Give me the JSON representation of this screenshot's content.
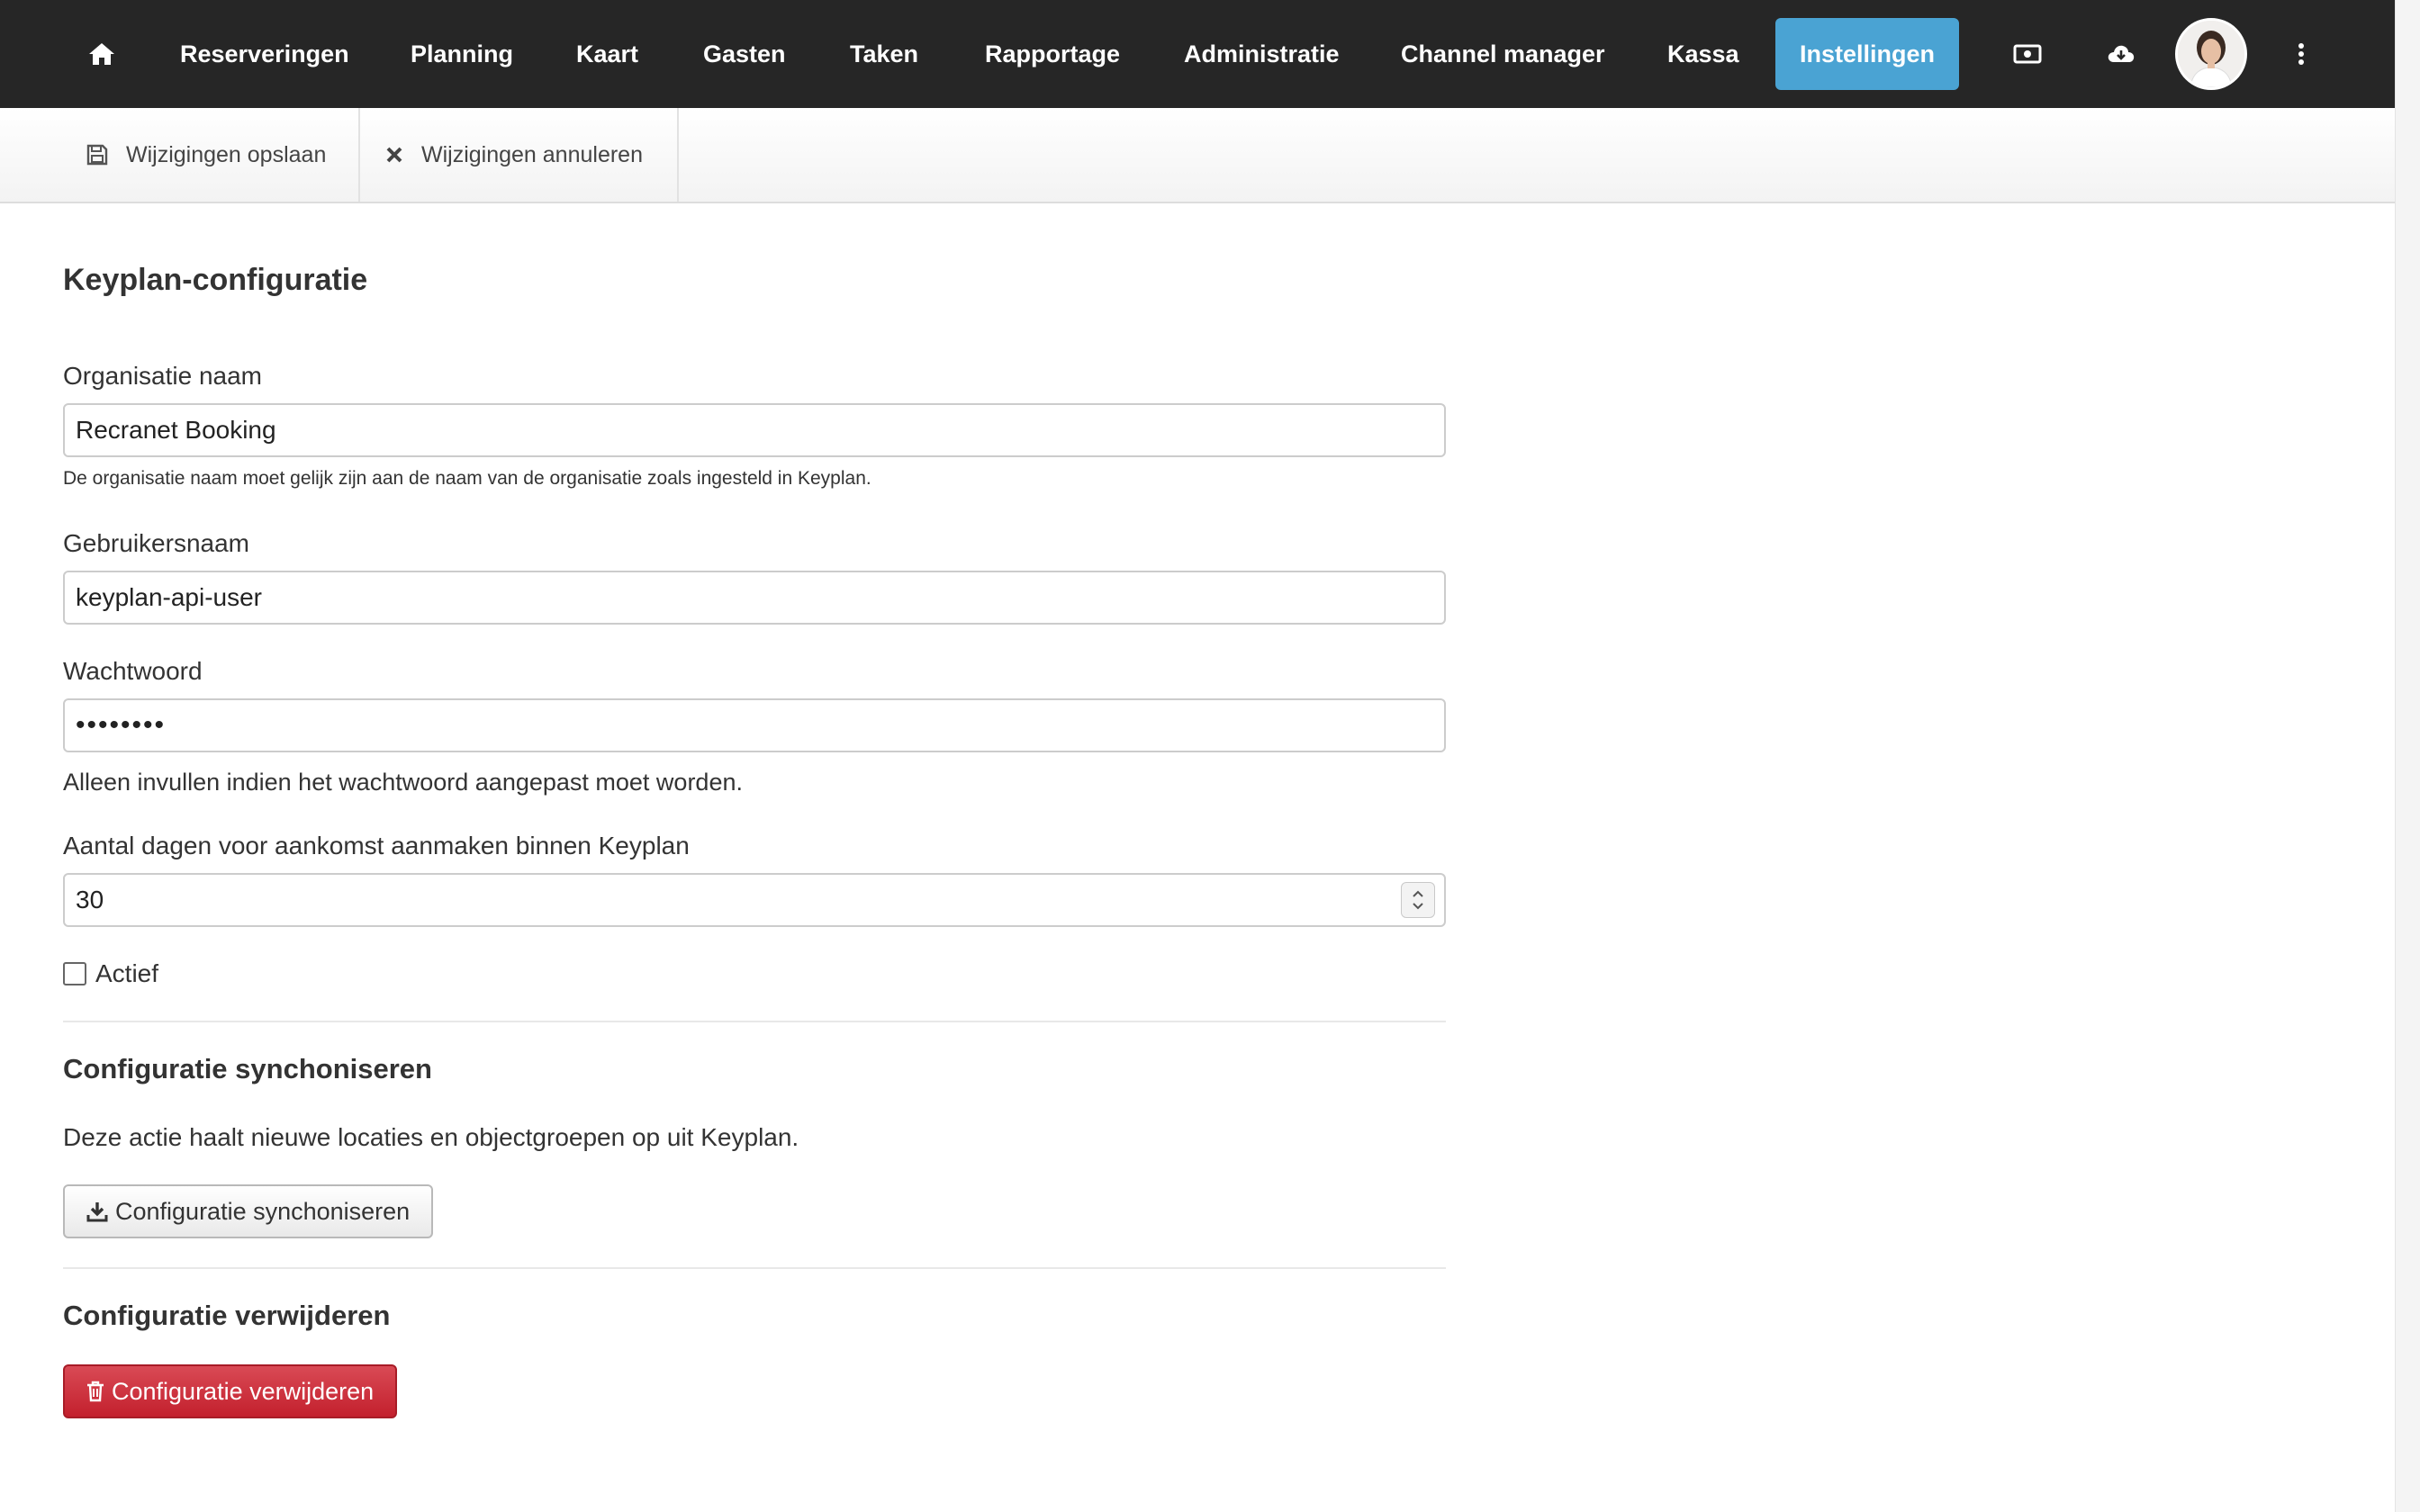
{
  "nav": {
    "home_icon": "home-icon",
    "items": [
      "Reserveringen",
      "Planning",
      "Kaart",
      "Gasten",
      "Taken",
      "Rapportage",
      "Administratie",
      "Channel manager",
      "Kassa"
    ],
    "active_item": "Instellingen",
    "active_color": "#4aa3d3",
    "right_icons": [
      "cash-register-icon",
      "cloud-download-icon",
      "avatar",
      "more-vertical-icon"
    ]
  },
  "toolbar": {
    "save_label": "Wijzigingen opslaan",
    "cancel_label": "Wijzigingen annuleren",
    "save_icon": "floppy-disk-icon",
    "cancel_icon": "close-icon"
  },
  "form": {
    "title": "Keyplan-configuratie",
    "organisation": {
      "label": "Organisatie naam",
      "value": "Recranet Booking",
      "help": "De organisatie naam moet gelijk zijn aan de naam van de organisatie zoals ingesteld in Keyplan."
    },
    "username": {
      "label": "Gebruikersnaam",
      "value": "keyplan-api-user"
    },
    "password": {
      "label": "Wachtwoord",
      "value": "••••••••",
      "help": "Alleen invullen indien het wachtwoord aangepast moet worden."
    },
    "days": {
      "label": "Aantal dagen voor aankomst aanmaken binnen Keyplan",
      "value": "30"
    },
    "active": {
      "label": "Actief",
      "checked": false
    }
  },
  "sync": {
    "title": "Configuratie synchoniseren",
    "description": "Deze actie haalt nieuwe locaties en objectgroepen op uit Keyplan.",
    "button_label": "Configuratie synchoniseren",
    "button_icon": "download-icon"
  },
  "delete": {
    "title": "Configuratie verwijderen",
    "button_label": "Configuratie verwijderen",
    "button_icon": "trash-icon",
    "button_color": "#c9302c"
  }
}
